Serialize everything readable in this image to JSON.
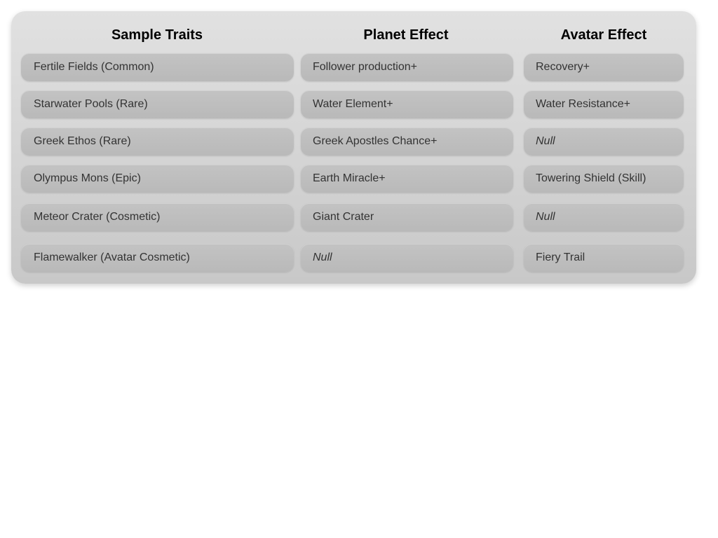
{
  "headers": {
    "traits": "Sample Traits",
    "planet": "Planet Effect",
    "avatar": "Avatar Effect"
  },
  "rows": [
    {
      "trait": "Fertile Fields (Common)",
      "planet": "Follower production+",
      "avatar": "Recovery+"
    },
    {
      "trait": "Starwater Pools (Rare)",
      "planet": "Water Element+",
      "avatar": "Water Resistance+"
    },
    {
      "trait": "Greek Ethos (Rare)",
      "planet": "Greek Apostles Chance+",
      "avatar": "Null"
    },
    {
      "trait": "Olympus Mons (Epic)",
      "planet": "Earth Miracle+",
      "avatar": "Towering Shield (Skill)"
    },
    {
      "trait": "Meteor Crater (Cosmetic)",
      "planet": "Giant Crater",
      "avatar": "Null"
    },
    {
      "trait": "Flamewalker (Avatar Cosmetic)",
      "planet": "Null",
      "avatar": "Fiery Trail"
    }
  ],
  "colors": {
    "panel": "#d8d8d8",
    "cell": "#bcbcbc",
    "cell_text": "#333333",
    "header_text": "#000000"
  }
}
